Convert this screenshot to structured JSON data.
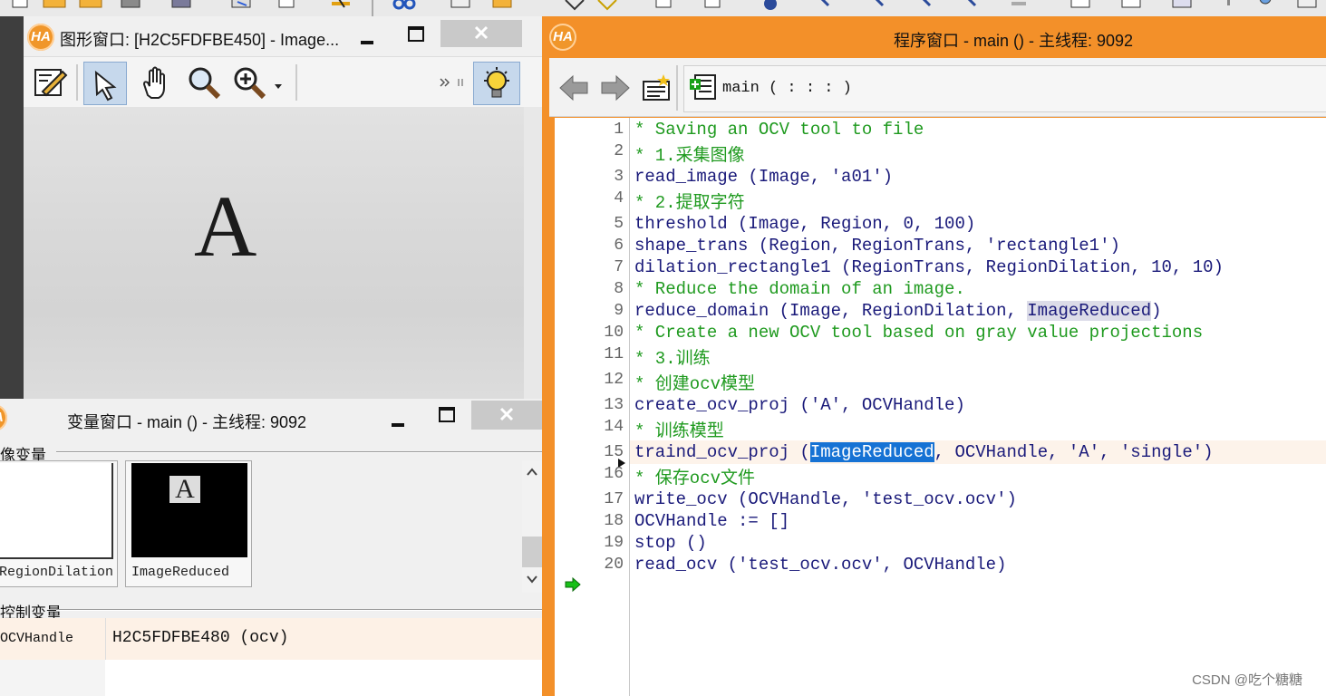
{
  "graphics_window": {
    "title": "图形窗口: [H2C5FDFBE450] - Image...",
    "letter": "A"
  },
  "variable_window": {
    "title": "变量窗口 - main () - 主线程: 9092",
    "iconic_section": "像变量",
    "control_section": "控制变量",
    "thumbnails": [
      {
        "caption": "RegionDilation"
      },
      {
        "caption": "ImageReduced",
        "letter": "A"
      }
    ],
    "control_vars": [
      {
        "name": "OCVHandle",
        "value": "H2C5FDFBE480 (ocv)"
      }
    ]
  },
  "program_window": {
    "title": "程序窗口 - main () - 主线程: 9092",
    "procedure_signature": "main ( : : : )",
    "lines": [
      {
        "num": "1",
        "text": "* Saving an OCV tool to file",
        "kind": "comment"
      },
      {
        "num": "2",
        "text": "* 1.采集图像",
        "kind": "comment"
      },
      {
        "num": "3",
        "text": "read_image (Image, 'a01')",
        "kind": "code"
      },
      {
        "num": "4",
        "text": "* 2.提取字符",
        "kind": "comment"
      },
      {
        "num": "5",
        "text": "threshold (Image, Region, 0, 100)",
        "kind": "code"
      },
      {
        "num": "6",
        "text": "shape_trans (Region, RegionTrans, 'rectangle1')",
        "kind": "code"
      },
      {
        "num": "7",
        "text": "dilation_rectangle1 (RegionTrans, RegionDilation, 10, 10)",
        "kind": "code"
      },
      {
        "num": "8",
        "text": "* Reduce the domain of an image.",
        "kind": "comment"
      },
      {
        "num": "9",
        "pre": "reduce_domain (Image, RegionDilation, ",
        "hl": "ImageReduced",
        "post": ")",
        "kind": "code"
      },
      {
        "num": "10",
        "text": "* Create a new OCV tool based on gray value projections",
        "kind": "comment"
      },
      {
        "num": "11",
        "text": "* 3.训练",
        "kind": "comment"
      },
      {
        "num": "12",
        "text": "* 创建ocv模型",
        "kind": "comment"
      },
      {
        "num": "13",
        "text": "create_ocv_proj ('A', OCVHandle)",
        "kind": "code"
      },
      {
        "num": "14",
        "text": "* 训练模型",
        "kind": "comment"
      },
      {
        "num": "15",
        "pre": "traind_ocv_proj (",
        "hl": "ImageReduced",
        "post": ", OCVHandle, 'A', 'single')",
        "kind": "code"
      },
      {
        "num": "16",
        "text": "* 保存ocv文件",
        "kind": "comment"
      },
      {
        "num": "17",
        "text": "write_ocv (OCVHandle, 'test_ocv.ocv')",
        "kind": "code"
      },
      {
        "num": "18",
        "text": "OCVHandle := []",
        "kind": "code"
      },
      {
        "num": "19",
        "text": "stop ()",
        "kind": "code"
      },
      {
        "num": "20",
        "text": "read_ocv ('test_ocv.ocv', OCVHandle)",
        "kind": "code"
      }
    ]
  },
  "logo_text": "HA",
  "watermark": "CSDN @吃个糖糖"
}
